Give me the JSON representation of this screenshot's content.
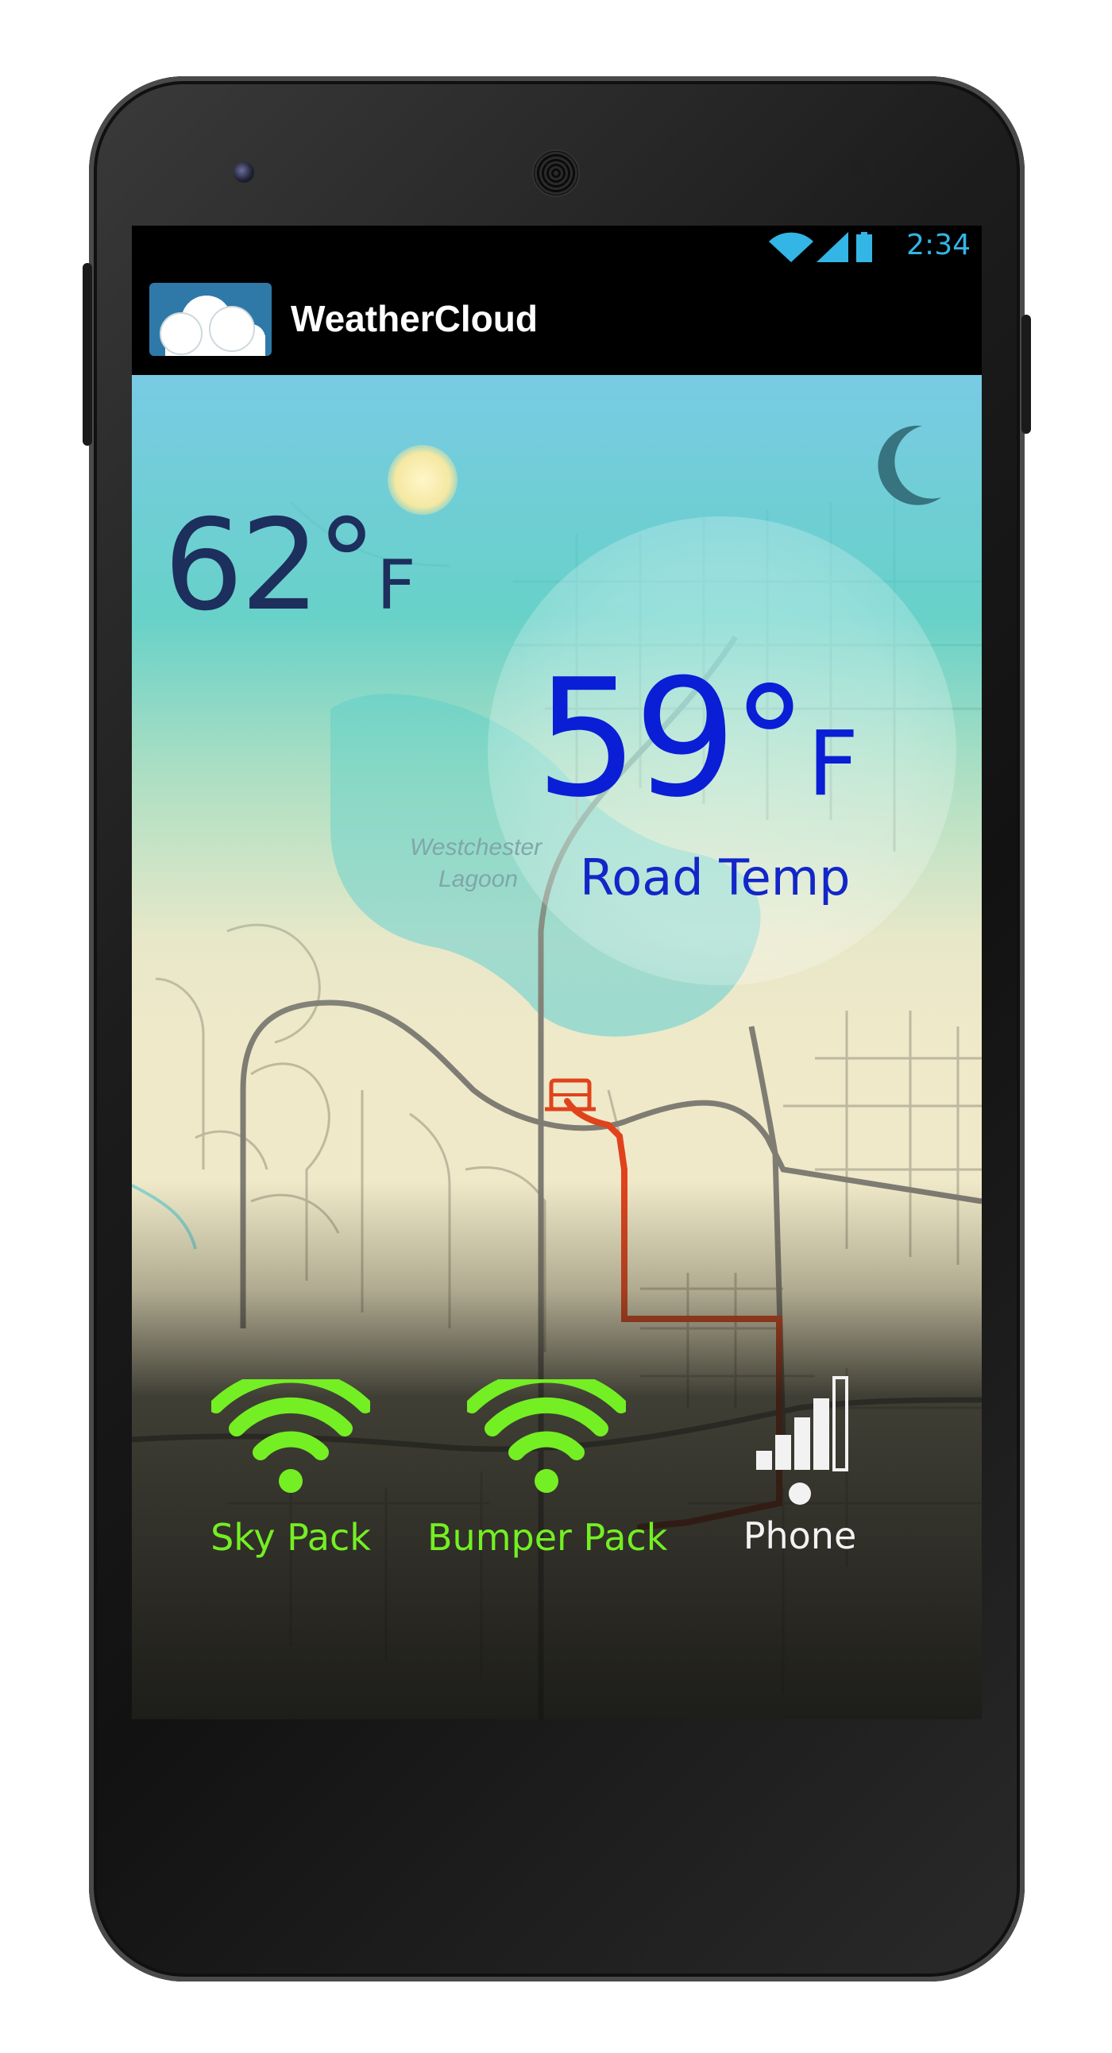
{
  "status_bar": {
    "time": "2:34",
    "icons": [
      "wifi-icon",
      "signal-icon",
      "battery-icon"
    ],
    "accent_color": "#33b5e5"
  },
  "app_bar": {
    "title": "WeatherCloud",
    "logo_icon": "cloud-logo-icon"
  },
  "weather": {
    "air_temperature": "62",
    "air_unit": "F",
    "road_temperature": "59",
    "road_unit": "F",
    "road_label": "Road Temp",
    "degree_symbol": "°"
  },
  "map": {
    "place_label_line1": "Westchester",
    "place_label_line2": "Lagoon"
  },
  "sensors": [
    {
      "label": "Sky Pack",
      "icon": "wifi-icon",
      "color": "#74ef23"
    },
    {
      "label": "Bumper Pack",
      "icon": "wifi-icon",
      "color": "#74ef23"
    },
    {
      "label": "Phone",
      "icon": "signal-strength-icon",
      "color": "#f2f2f2"
    }
  ],
  "colors": {
    "route": "#e0431c",
    "road_temp_text": "#0a1ed6",
    "air_temp_text": "#1d2f5c"
  }
}
